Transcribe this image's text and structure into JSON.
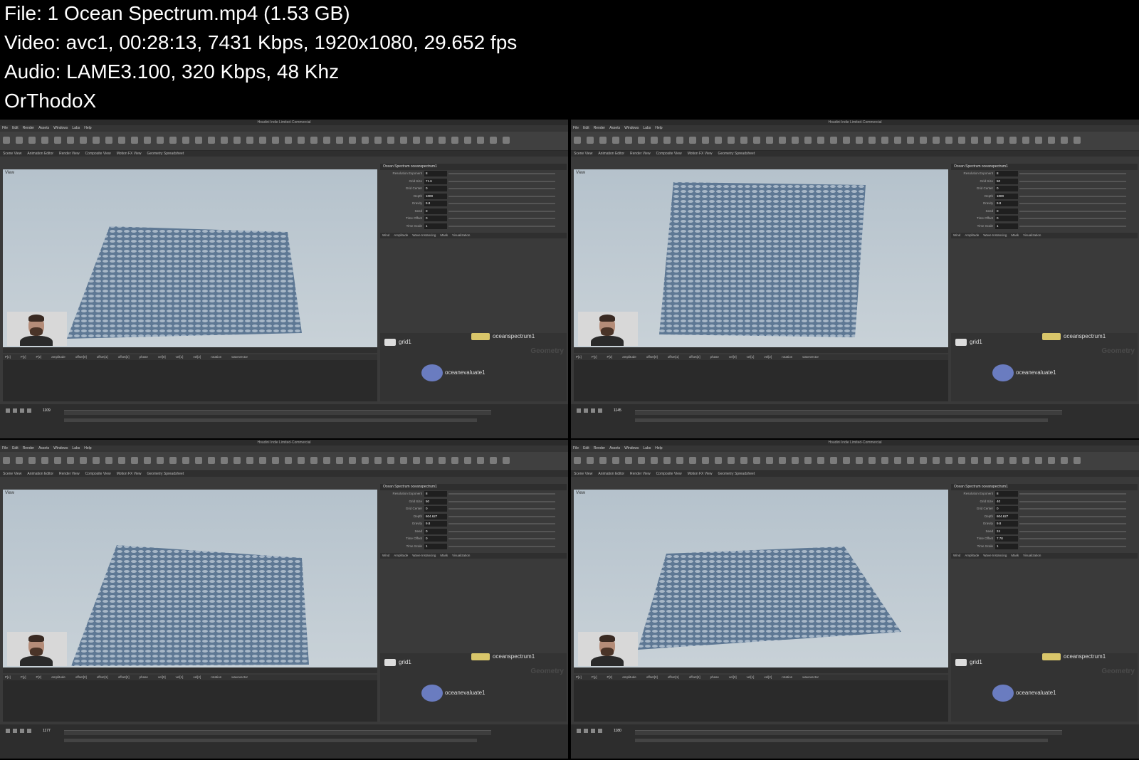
{
  "info": {
    "file": "File: 1  Ocean Spectrum.mp4 (1.53 GB)",
    "video": "Video: avc1, 00:28:13, 7431 Kbps, 1920x1080, 29.652 fps",
    "audio": "Audio: LAME3.100, 320 Kbps, 48 Khz",
    "credit": "OrThodoX"
  },
  "app": {
    "title": "Houdini Indie Limited-Commercial",
    "menu": [
      "File",
      "Edit",
      "Render",
      "Assets",
      "Windows",
      "Labs",
      "Help"
    ],
    "tabs": [
      "Scene View",
      "Animation Editor",
      "Render View",
      "Composite View",
      "Motion FX View",
      "Geometry Spreadsheet"
    ],
    "viewport_label": "View",
    "net_context": "Geometry",
    "param_header": "Ocean Spectrum  oceanspectrum1",
    "param_tabs": [
      "Wind",
      "Amplitude",
      "Wave Instancing",
      "Mask",
      "Visualization"
    ],
    "nodes": {
      "grid": "grid1",
      "spectrum": "oceanspectrum1",
      "evaluate": "oceanevaluate1"
    },
    "sheet_headers": [
      "P[x]",
      "P[y]",
      "P[z]",
      "amplitude",
      "offset[0]",
      "offset[1]",
      "offset[2]",
      "phase",
      "vel[0]",
      "vel[1]",
      "vel[2]",
      "rotation",
      "wavevector"
    ]
  },
  "frames": [
    {
      "labels": [
        "Resolution Exponent",
        "Grid Size",
        "Grid Center",
        "Depth",
        "Gravity",
        "Seed",
        "Time Offset",
        "Time Scale"
      ],
      "values": [
        "8",
        "71.6",
        "0",
        "1000",
        "9.8",
        "0",
        "0",
        "1"
      ],
      "frame": "1109"
    },
    {
      "labels": [
        "Resolution Exponent",
        "Grid Size",
        "Grid Center",
        "Depth",
        "Gravity",
        "Seed",
        "Time Offset",
        "Time Scale"
      ],
      "values": [
        "8",
        "50",
        "0",
        "1000",
        "9.8",
        "0",
        "0",
        "1"
      ],
      "frame": "1145"
    },
    {
      "labels": [
        "Resolution Exponent",
        "Grid Size",
        "Grid Center",
        "Depth",
        "Gravity",
        "Seed",
        "Time Offset",
        "Time Scale"
      ],
      "values": [
        "8",
        "50",
        "0",
        "604.627",
        "9.8",
        "0",
        "0",
        "1"
      ],
      "frame": "1177"
    },
    {
      "labels": [
        "Resolution Exponent",
        "Grid Size",
        "Grid Center",
        "Depth",
        "Gravity",
        "Seed",
        "Time Offset",
        "Time Scale"
      ],
      "values": [
        "8",
        "40",
        "0",
        "604.627",
        "9.8",
        "24",
        "7.78",
        "1"
      ],
      "frame": "1180"
    }
  ],
  "colors": {
    "ocean_light": "#c6d2de",
    "ocean_dark": "#5e7894",
    "sky": "#bcc7cf",
    "node_yellow": "#d9c66a"
  }
}
